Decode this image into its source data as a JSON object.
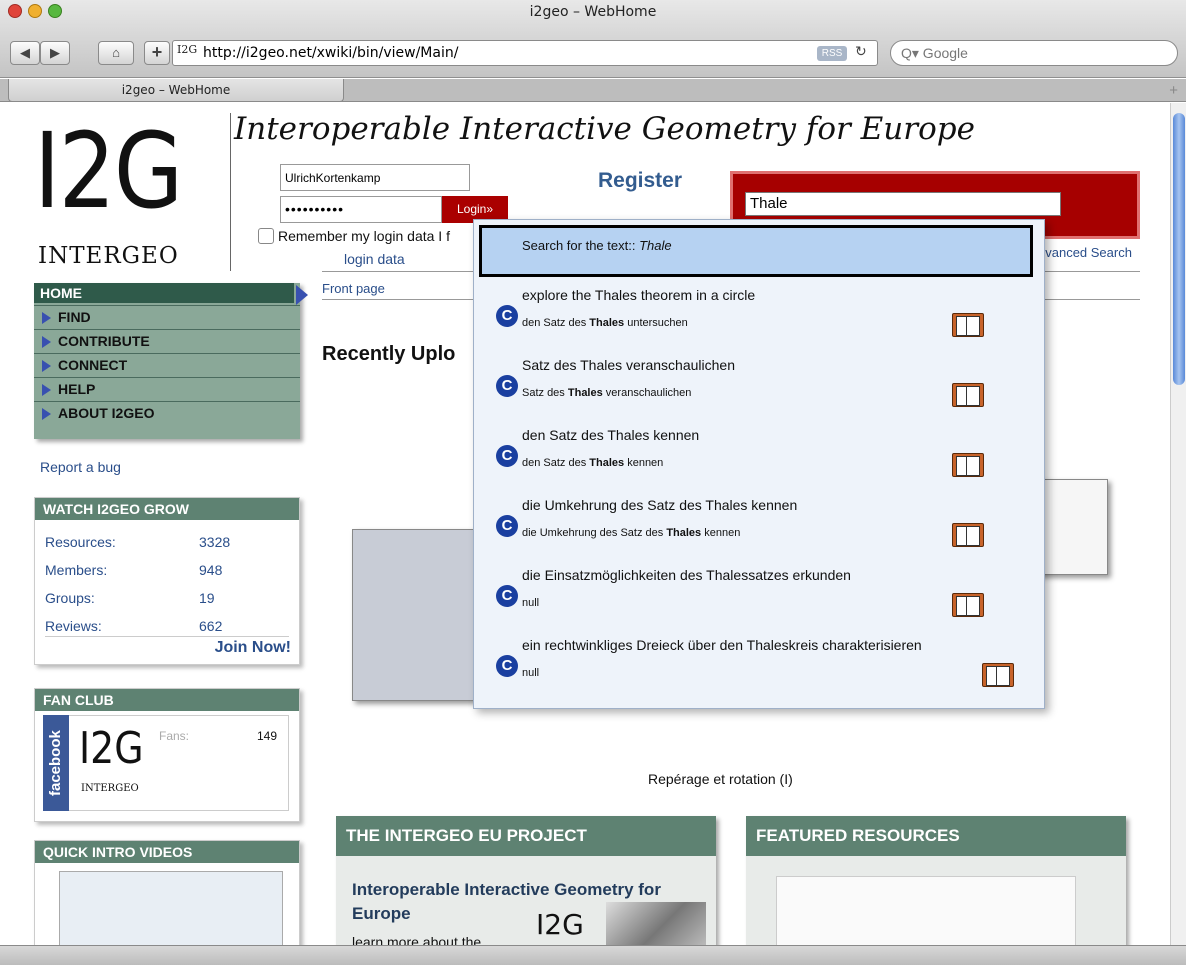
{
  "window": {
    "title": "i2geo – WebHome"
  },
  "toolbar": {
    "back": "◀",
    "forward": "▶",
    "home": "⌂",
    "add": "+",
    "favicon": "I2G",
    "url": "http://i2geo.net/xwiki/bin/view/Main/",
    "rss": "RSS",
    "reload": "↻",
    "search_placeholder": "Q▾ Google"
  },
  "tabs": [
    {
      "label": "i2geo – WebHome"
    }
  ],
  "tab_add": "+",
  "header": {
    "logo": "I2G",
    "logo_sub": "INTERGEO",
    "tagline": "Interoperable Interactive Geometry for Europe"
  },
  "login": {
    "username": "UlrichKortenkamp",
    "password_mask": "••••••••••",
    "button": "Login»",
    "remember": "Remember my login data",
    "remember_tail": "I f",
    "login_data": "login data",
    "register": "Register"
  },
  "search": {
    "value": "Thale",
    "advanced": "Advanced Search",
    "advanced_visible": "dvanced Search"
  },
  "breadcrumb": "Front page",
  "recent_heading": "Recently Uplo",
  "nav": {
    "home": "HOME",
    "items": [
      {
        "label": "FIND"
      },
      {
        "label": "CONTRIBUTE"
      },
      {
        "label": "CONNECT"
      },
      {
        "label": "HELP"
      },
      {
        "label": "ABOUT I2GEO"
      }
    ]
  },
  "report_bug": "Report a bug",
  "grow": {
    "title": "WATCH I2GEO GROW",
    "stats": [
      {
        "label": "Resources:",
        "value": "3328"
      },
      {
        "label": "Members:",
        "value": "948"
      },
      {
        "label": "Groups:",
        "value": "19"
      },
      {
        "label": "Reviews:",
        "value": "662"
      }
    ],
    "join": "Join Now!"
  },
  "fanclub": {
    "title": "FAN CLUB",
    "facebook": "facebook",
    "logo": "I2G",
    "logo_sub": "INTERGEO",
    "fans_label": "Fans:",
    "fans": "149"
  },
  "videos": {
    "title": "QUICK INTRO VIDEOS"
  },
  "suggestions": {
    "selected_prefix": "Search for the text::",
    "selected_term": "Thale",
    "items": [
      {
        "title": "explore the Thales theorem in a circle",
        "sub_pre": "den Satz des",
        "sub_bold": "Thales",
        "sub_post": "untersuchen"
      },
      {
        "title": "Satz des Thales veranschaulichen",
        "sub_pre": "Satz des",
        "sub_bold": "Thales",
        "sub_post": "veranschaulichen"
      },
      {
        "title": "den Satz des Thales kennen",
        "sub_pre": "den Satz des",
        "sub_bold": "Thales",
        "sub_post": "kennen"
      },
      {
        "title": "die Umkehrung des Satz des Thales kennen",
        "sub_pre": "die Umkehrung des Satz des",
        "sub_bold": "Thales",
        "sub_post": "kennen"
      },
      {
        "title": "die Einsatzmöglichkeiten des Thalessatzes erkunden",
        "sub_pre": "null",
        "sub_bold": "",
        "sub_post": ""
      },
      {
        "title": "ein rechtwinkliges Dreieck über den Thaleskreis charakterisieren",
        "sub_pre": "null",
        "sub_bold": "",
        "sub_post": ""
      }
    ],
    "icon_letter": "C"
  },
  "caption": "Repérage et rotation (I)",
  "project": {
    "title": "THE INTERGEO EU PROJECT",
    "heading": "Interoperable Interactive Geometry for Europe",
    "learn": "learn more about the",
    "logo": "I2G"
  },
  "featured": {
    "title": "FEATURED RESOURCES"
  },
  "colors": {
    "nav_bg": "#8aa898",
    "nav_head": "#2f5a4a",
    "box_head": "#5e8272",
    "search_red": "#a60000",
    "link": "#2a4e8a"
  }
}
